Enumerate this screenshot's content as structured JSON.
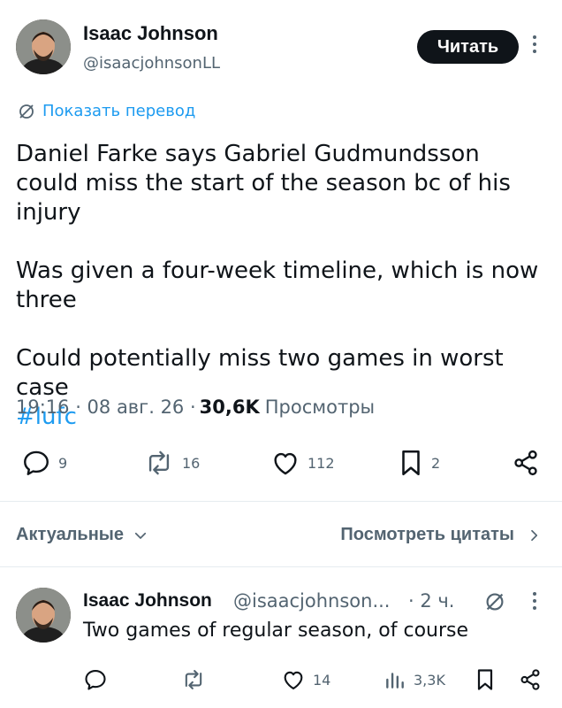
{
  "tweet": {
    "author": {
      "name": "Isaac Johnson",
      "handle": "@isaacjohnsonLL"
    },
    "follow_label": "Читать",
    "translate_label": "Показать перевод",
    "paragraphs": [
      "Daniel Farke says Gabriel Gudmundsson could miss the start of the season bc of his injury",
      "Was given a four-week timeline, which is now three",
      "Could potentially miss two games in worst case"
    ],
    "hashtag": "#lufc",
    "timestamp": "19:16 · 08 авг. 26 ·",
    "views_count": "30,6K",
    "views_label": "Просмотры",
    "stats": {
      "replies": "9",
      "reposts": "16",
      "likes": "112",
      "bookmarks": "2"
    }
  },
  "replies_header": {
    "sort_label": "Актуальные",
    "quotes_label": "Посмотреть цитаты"
  },
  "reply": {
    "author_name": "Isaac Johnson",
    "author_handle": "@isaacjohnson...",
    "time": "· 2 ч.",
    "text": "Two games of regular season, of course",
    "stats": {
      "likes": "14",
      "views": "3,3K"
    }
  },
  "colors": {
    "accent": "#1d9bf0",
    "text": "#0f1419",
    "muted": "#536471",
    "button": "#0f1419"
  },
  "icons": [
    "reply-icon",
    "repost-icon",
    "like-icon",
    "bookmark-icon",
    "share-icon",
    "translate-icon",
    "more-icon",
    "chevron-down-icon",
    "chevron-right-icon",
    "views-icon"
  ]
}
